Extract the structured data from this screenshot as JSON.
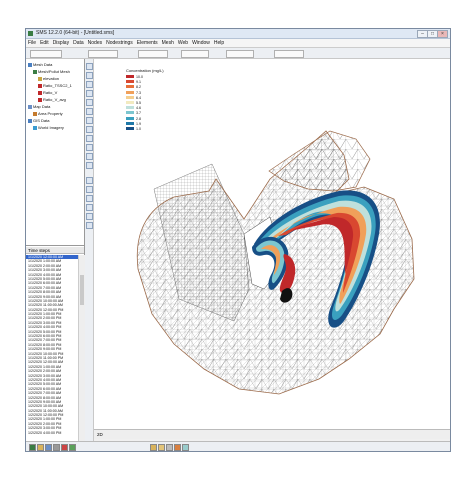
{
  "window": {
    "title": "SMS 12.2.0 (64-bit) - [Untitled.sms]"
  },
  "menu": [
    "File",
    "Edit",
    "Display",
    "Data",
    "Nodes",
    "Nodestrings",
    "Elements",
    "Mesh",
    "Web",
    "Window",
    "Help"
  ],
  "tree": {
    "items": [
      {
        "label": "Mesh Data",
        "level": 0
      },
      {
        "label": "Mesh/Pollut Mesh",
        "level": 1
      },
      {
        "label": "elevation",
        "level": 2
      },
      {
        "label": "Ratio_TSSC2_1",
        "level": 2
      },
      {
        "label": "Ratio_V",
        "level": 2
      },
      {
        "label": "Ratio_V_avg",
        "level": 2
      },
      {
        "label": "Map Data",
        "level": 0
      },
      {
        "label": "Area Property",
        "level": 1
      },
      {
        "label": "GIS Data",
        "level": 0
      },
      {
        "label": "World Imagery",
        "level": 1
      }
    ]
  },
  "time_steps": {
    "header": "Time steps",
    "selected_index": 0,
    "items": [
      "1/1/2020 12:00:00 AM",
      "1/1/2020 1:00:00 AM",
      "1/1/2020 2:00:00 AM",
      "1/1/2020 3:00:00 AM",
      "1/1/2020 4:00:00 AM",
      "1/1/2020 5:00:00 AM",
      "1/1/2020 6:00:00 AM",
      "1/1/2020 7:00:00 AM",
      "1/1/2020 8:00:00 AM",
      "1/1/2020 9:00:00 AM",
      "1/1/2020 10:00:00 AM",
      "1/1/2020 11:00:00 AM",
      "1/1/2020 12:00:00 PM",
      "1/1/2020 1:00:00 PM",
      "1/1/2020 2:00:00 PM",
      "1/1/2020 3:00:00 PM",
      "1/1/2020 4:00:00 PM",
      "1/1/2020 5:00:00 PM",
      "1/1/2020 6:00:00 PM",
      "1/1/2020 7:00:00 PM",
      "1/1/2020 8:00:00 PM",
      "1/1/2020 9:00:00 PM",
      "1/1/2020 10:00:00 PM",
      "1/1/2020 11:00:00 PM",
      "1/2/2020 12:00:00 AM",
      "1/2/2020 1:00:00 AM",
      "1/2/2020 2:00:00 AM",
      "1/2/2020 3:00:00 AM",
      "1/2/2020 4:00:00 AM",
      "1/2/2020 5:00:00 AM",
      "1/2/2020 6:00:00 AM",
      "1/2/2020 7:00:00 AM",
      "1/2/2020 8:00:00 AM",
      "1/2/2020 9:00:00 AM",
      "1/2/2020 10:00:00 AM",
      "1/2/2020 11:00:00 AM",
      "1/2/2020 12:00:00 PM",
      "1/2/2020 1:00:00 PM",
      "1/2/2020 2:00:00 PM",
      "1/2/2020 3:00:00 PM",
      "1/2/2020 4:00:00 PM"
    ]
  },
  "legend": {
    "title": "Concentration (mg/L)",
    "entries": [
      {
        "label": "10.0",
        "color": "#c0282a"
      },
      {
        "label": "9.1",
        "color": "#d94830"
      },
      {
        "label": "8.2",
        "color": "#e7703a"
      },
      {
        "label": "7.3",
        "color": "#f0a05a"
      },
      {
        "label": "6.4",
        "color": "#f5cf90"
      },
      {
        "label": "5.5",
        "color": "#f2eac0"
      },
      {
        "label": "4.6",
        "color": "#bfe0dc"
      },
      {
        "label": "3.7",
        "color": "#7cc6d0"
      },
      {
        "label": "2.8",
        "color": "#3aa0bf"
      },
      {
        "label": "1.9",
        "color": "#1f78a8"
      },
      {
        "label": "1.0",
        "color": "#174f86"
      }
    ]
  },
  "status": {
    "left": "2D"
  },
  "colors": {
    "mesh_line": "#444444",
    "boundary": "#9b6a4a"
  }
}
